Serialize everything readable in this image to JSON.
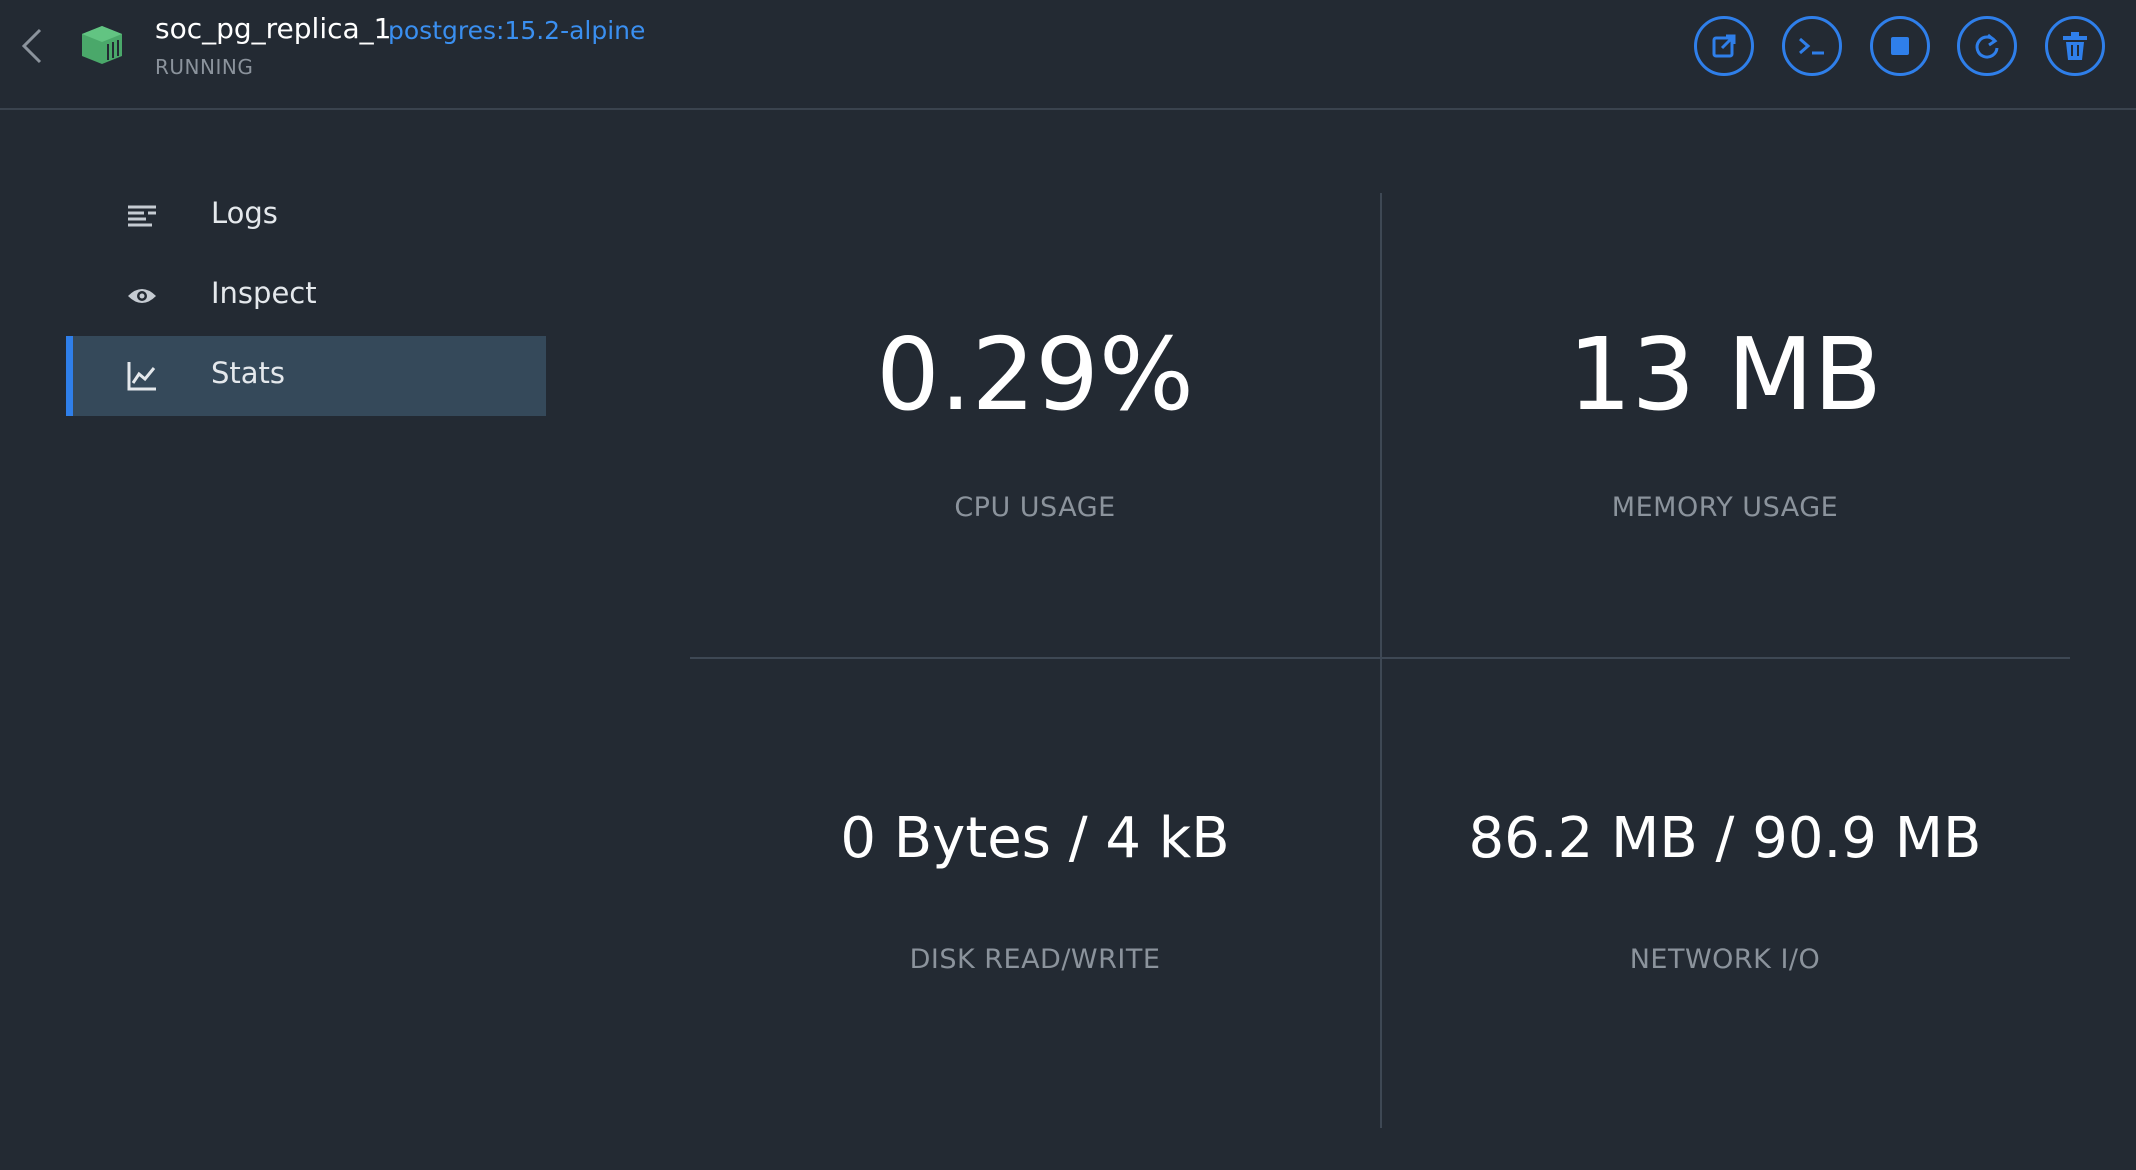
{
  "header": {
    "container_name": "soc_pg_replica_1",
    "image": "postgres:15.2-alpine",
    "status": "RUNNING",
    "container_icon_color": "#4aa86a",
    "accent_color": "#2f7fea",
    "actions": [
      {
        "icon": "open-external-icon"
      },
      {
        "icon": "terminal-icon"
      },
      {
        "icon": "stop-icon"
      },
      {
        "icon": "restart-icon"
      },
      {
        "icon": "delete-icon"
      }
    ]
  },
  "sidebar": {
    "items": [
      {
        "label": "Logs",
        "icon": "logs-icon",
        "active": false
      },
      {
        "label": "Inspect",
        "icon": "eye-icon",
        "active": false
      },
      {
        "label": "Stats",
        "icon": "chart-icon",
        "active": true
      }
    ]
  },
  "stats": {
    "cpu": {
      "value": "0.29%",
      "label": "CPU USAGE"
    },
    "memory": {
      "value": "13 MB",
      "label": "MEMORY USAGE"
    },
    "disk": {
      "value": "0 Bytes / 4 kB",
      "label": "DISK READ/WRITE"
    },
    "network": {
      "value": "86.2 MB / 90.9 MB",
      "label": "NETWORK I/O"
    }
  }
}
